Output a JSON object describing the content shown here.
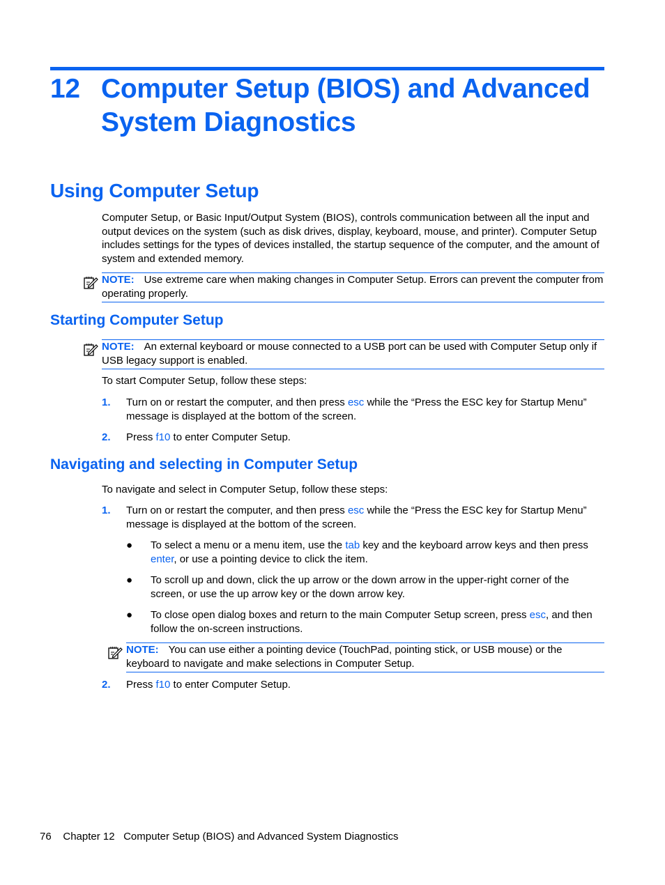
{
  "chapter": {
    "number": "12",
    "title": "Computer Setup (BIOS) and Advanced System Diagnostics"
  },
  "section": {
    "title": "Using Computer Setup",
    "intro": "Computer Setup, or Basic Input/Output System (BIOS), controls communication between all the input and output devices on the system (such as disk drives, display, keyboard, mouse, and printer). Computer Setup includes settings for the types of devices installed, the startup sequence of the computer, and the amount of system and extended memory.",
    "note1": {
      "label": "NOTE:",
      "text": "Use extreme care when making changes in Computer Setup. Errors can prevent the computer from operating properly."
    }
  },
  "starting": {
    "title": "Starting Computer Setup",
    "note": {
      "label": "NOTE:",
      "text": "An external keyboard or mouse connected to a USB port can be used with Computer Setup only if USB legacy support is enabled."
    },
    "intro": "To start Computer Setup, follow these steps:",
    "steps": [
      {
        "num": "1.",
        "before": "Turn on or restart the computer, and then press ",
        "key": "esc",
        "after": " while the “Press the ESC key for Startup Menu” message is displayed at the bottom of the screen."
      },
      {
        "num": "2.",
        "before": "Press ",
        "key": "f10",
        "after": " to enter Computer Setup."
      }
    ]
  },
  "navigating": {
    "title": "Navigating and selecting in Computer Setup",
    "intro": "To navigate and select in Computer Setup, follow these steps:",
    "step1": {
      "num": "1.",
      "before": "Turn on or restart the computer, and then press ",
      "key": "esc",
      "after": " while the “Press the ESC key for Startup Menu” message is displayed at the bottom of the screen."
    },
    "bullets": [
      {
        "dot": "●",
        "p1": "To select a menu or a menu item, use the ",
        "k1": "tab",
        "p2": " key and the keyboard arrow keys and then press ",
        "k2": "enter",
        "p3": ", or use a pointing device to click the item."
      },
      {
        "dot": "●",
        "p1": "To scroll up and down, click the up arrow or the down arrow in the upper-right corner of the screen, or use the up arrow key or the down arrow key."
      },
      {
        "dot": "●",
        "p1": "To close open dialog boxes and return to the main Computer Setup screen, press ",
        "k1": "esc",
        "p2": ", and then follow the on-screen instructions."
      }
    ],
    "note": {
      "label": "NOTE:",
      "text": "You can use either a pointing device (TouchPad, pointing stick, or USB mouse) or the keyboard to navigate and make selections in Computer Setup."
    },
    "step2": {
      "num": "2.",
      "before": "Press ",
      "key": "f10",
      "after": " to enter Computer Setup."
    }
  },
  "footer": {
    "page_number": "76",
    "chapter_label": "Chapter 12",
    "chapter_title": "Computer Setup (BIOS) and Advanced System Diagnostics"
  }
}
